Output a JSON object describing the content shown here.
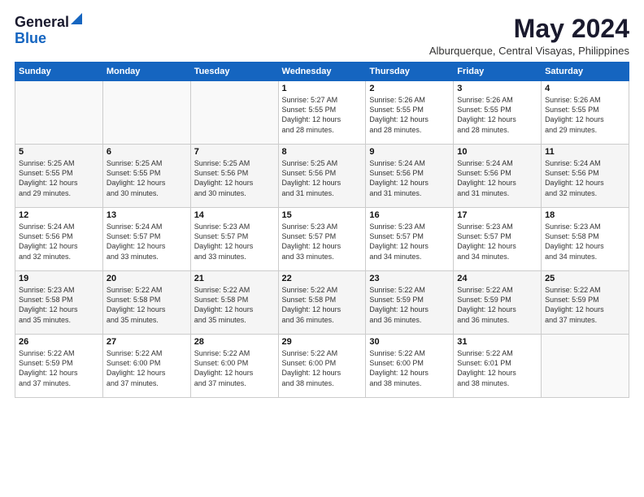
{
  "logo": {
    "line1": "General",
    "line2": "Blue"
  },
  "title": "May 2024",
  "location": "Alburquerque, Central Visayas, Philippines",
  "days_header": [
    "Sunday",
    "Monday",
    "Tuesday",
    "Wednesday",
    "Thursday",
    "Friday",
    "Saturday"
  ],
  "weeks": [
    [
      {
        "day": "",
        "info": ""
      },
      {
        "day": "",
        "info": ""
      },
      {
        "day": "",
        "info": ""
      },
      {
        "day": "1",
        "info": "Sunrise: 5:27 AM\nSunset: 5:55 PM\nDaylight: 12 hours\nand 28 minutes."
      },
      {
        "day": "2",
        "info": "Sunrise: 5:26 AM\nSunset: 5:55 PM\nDaylight: 12 hours\nand 28 minutes."
      },
      {
        "day": "3",
        "info": "Sunrise: 5:26 AM\nSunset: 5:55 PM\nDaylight: 12 hours\nand 28 minutes."
      },
      {
        "day": "4",
        "info": "Sunrise: 5:26 AM\nSunset: 5:55 PM\nDaylight: 12 hours\nand 29 minutes."
      }
    ],
    [
      {
        "day": "5",
        "info": "Sunrise: 5:25 AM\nSunset: 5:55 PM\nDaylight: 12 hours\nand 29 minutes."
      },
      {
        "day": "6",
        "info": "Sunrise: 5:25 AM\nSunset: 5:55 PM\nDaylight: 12 hours\nand 30 minutes."
      },
      {
        "day": "7",
        "info": "Sunrise: 5:25 AM\nSunset: 5:56 PM\nDaylight: 12 hours\nand 30 minutes."
      },
      {
        "day": "8",
        "info": "Sunrise: 5:25 AM\nSunset: 5:56 PM\nDaylight: 12 hours\nand 31 minutes."
      },
      {
        "day": "9",
        "info": "Sunrise: 5:24 AM\nSunset: 5:56 PM\nDaylight: 12 hours\nand 31 minutes."
      },
      {
        "day": "10",
        "info": "Sunrise: 5:24 AM\nSunset: 5:56 PM\nDaylight: 12 hours\nand 31 minutes."
      },
      {
        "day": "11",
        "info": "Sunrise: 5:24 AM\nSunset: 5:56 PM\nDaylight: 12 hours\nand 32 minutes."
      }
    ],
    [
      {
        "day": "12",
        "info": "Sunrise: 5:24 AM\nSunset: 5:56 PM\nDaylight: 12 hours\nand 32 minutes."
      },
      {
        "day": "13",
        "info": "Sunrise: 5:24 AM\nSunset: 5:57 PM\nDaylight: 12 hours\nand 33 minutes."
      },
      {
        "day": "14",
        "info": "Sunrise: 5:23 AM\nSunset: 5:57 PM\nDaylight: 12 hours\nand 33 minutes."
      },
      {
        "day": "15",
        "info": "Sunrise: 5:23 AM\nSunset: 5:57 PM\nDaylight: 12 hours\nand 33 minutes."
      },
      {
        "day": "16",
        "info": "Sunrise: 5:23 AM\nSunset: 5:57 PM\nDaylight: 12 hours\nand 34 minutes."
      },
      {
        "day": "17",
        "info": "Sunrise: 5:23 AM\nSunset: 5:57 PM\nDaylight: 12 hours\nand 34 minutes."
      },
      {
        "day": "18",
        "info": "Sunrise: 5:23 AM\nSunset: 5:58 PM\nDaylight: 12 hours\nand 34 minutes."
      }
    ],
    [
      {
        "day": "19",
        "info": "Sunrise: 5:23 AM\nSunset: 5:58 PM\nDaylight: 12 hours\nand 35 minutes."
      },
      {
        "day": "20",
        "info": "Sunrise: 5:22 AM\nSunset: 5:58 PM\nDaylight: 12 hours\nand 35 minutes."
      },
      {
        "day": "21",
        "info": "Sunrise: 5:22 AM\nSunset: 5:58 PM\nDaylight: 12 hours\nand 35 minutes."
      },
      {
        "day": "22",
        "info": "Sunrise: 5:22 AM\nSunset: 5:58 PM\nDaylight: 12 hours\nand 36 minutes."
      },
      {
        "day": "23",
        "info": "Sunrise: 5:22 AM\nSunset: 5:59 PM\nDaylight: 12 hours\nand 36 minutes."
      },
      {
        "day": "24",
        "info": "Sunrise: 5:22 AM\nSunset: 5:59 PM\nDaylight: 12 hours\nand 36 minutes."
      },
      {
        "day": "25",
        "info": "Sunrise: 5:22 AM\nSunset: 5:59 PM\nDaylight: 12 hours\nand 37 minutes."
      }
    ],
    [
      {
        "day": "26",
        "info": "Sunrise: 5:22 AM\nSunset: 5:59 PM\nDaylight: 12 hours\nand 37 minutes."
      },
      {
        "day": "27",
        "info": "Sunrise: 5:22 AM\nSunset: 6:00 PM\nDaylight: 12 hours\nand 37 minutes."
      },
      {
        "day": "28",
        "info": "Sunrise: 5:22 AM\nSunset: 6:00 PM\nDaylight: 12 hours\nand 37 minutes."
      },
      {
        "day": "29",
        "info": "Sunrise: 5:22 AM\nSunset: 6:00 PM\nDaylight: 12 hours\nand 38 minutes."
      },
      {
        "day": "30",
        "info": "Sunrise: 5:22 AM\nSunset: 6:00 PM\nDaylight: 12 hours\nand 38 minutes."
      },
      {
        "day": "31",
        "info": "Sunrise: 5:22 AM\nSunset: 6:01 PM\nDaylight: 12 hours\nand 38 minutes."
      },
      {
        "day": "",
        "info": ""
      }
    ]
  ]
}
